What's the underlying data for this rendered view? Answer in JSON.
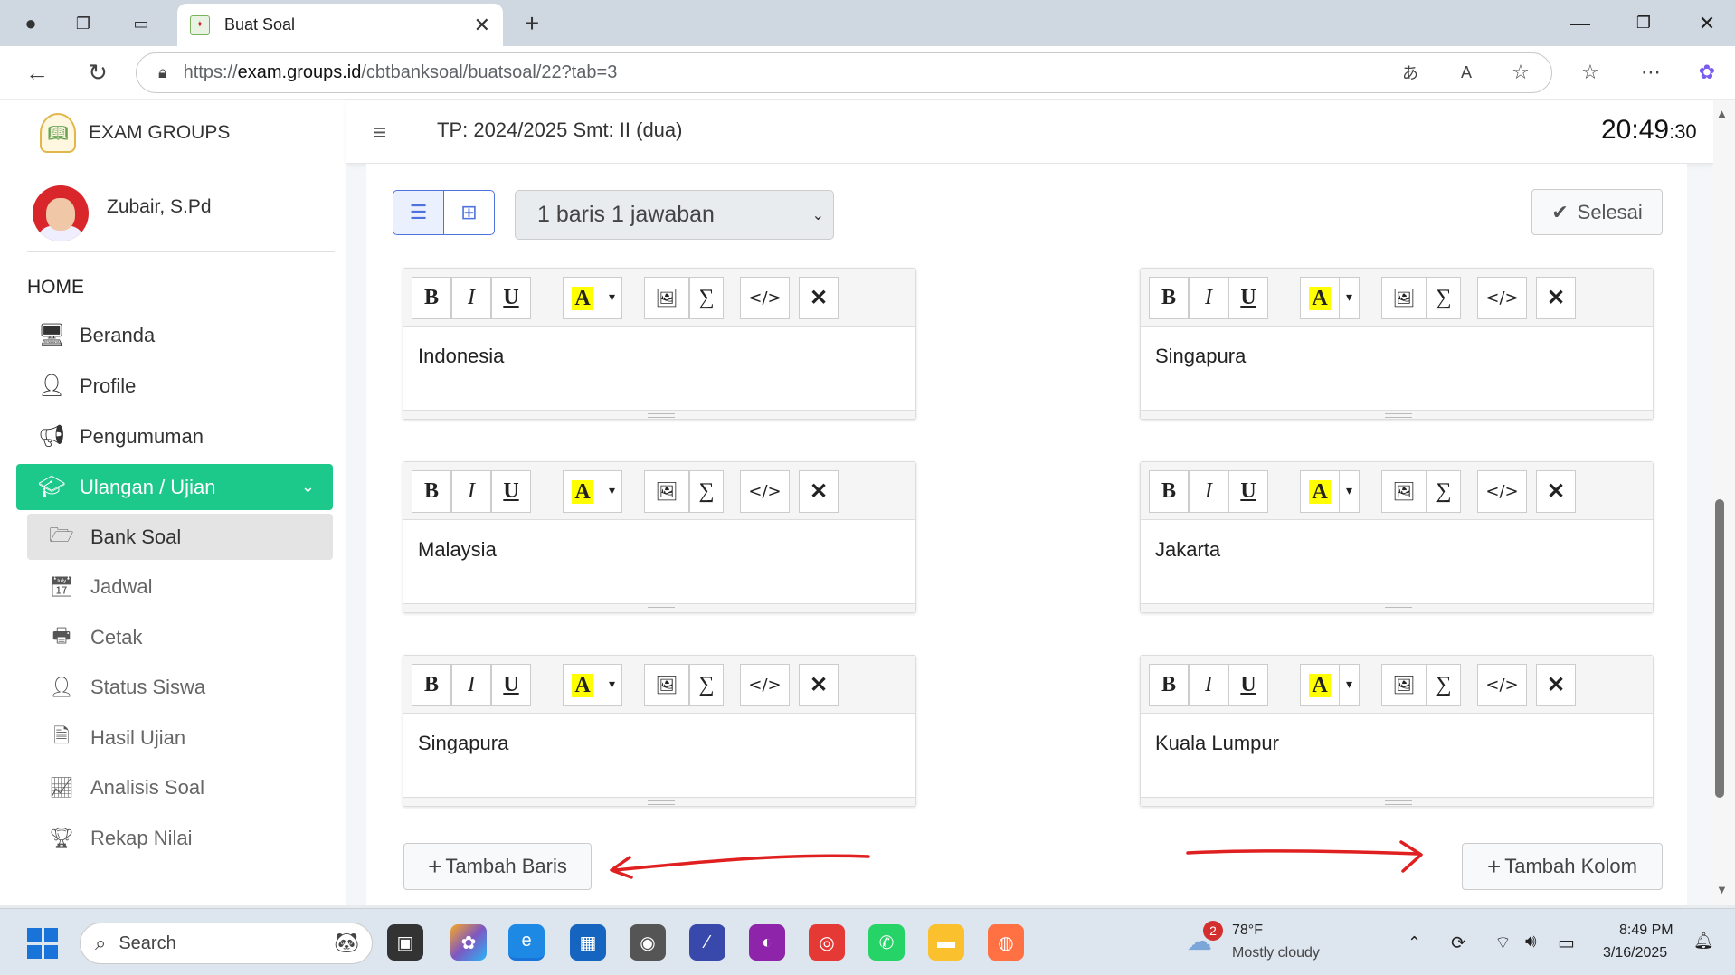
{
  "browser": {
    "tab_title": "Buat Soal",
    "url_prefix": "https://",
    "url_domain": "exam.groups.id",
    "url_path": "/cbtbanksoal/buatsoal/22?tab=3"
  },
  "sidebar": {
    "brand": "EXAM GROUPS",
    "user_name": "Zubair, S.Pd",
    "section_header": "HOME",
    "items": [
      {
        "label": "Beranda",
        "icon": "desktop-icon"
      },
      {
        "label": "Profile",
        "icon": "user-icon"
      },
      {
        "label": "Pengumuman",
        "icon": "bullhorn-icon"
      },
      {
        "label": "Ulangan / Ujian",
        "icon": "teacher-icon"
      }
    ],
    "subitems": [
      {
        "label": "Bank Soal",
        "icon": "folder-open-icon"
      },
      {
        "label": "Jadwal",
        "icon": "calendar-icon"
      },
      {
        "label": "Cetak",
        "icon": "print-icon"
      },
      {
        "label": "Status Siswa",
        "icon": "user-clock-icon"
      },
      {
        "label": "Hasil Ujian",
        "icon": "file-icon"
      },
      {
        "label": "Analisis Soal",
        "icon": "chart-line-icon"
      },
      {
        "label": "Rekap Nilai",
        "icon": "trophy-icon"
      }
    ]
  },
  "header": {
    "title": "TP: 2024/2025 Smt: II (dua)",
    "clock_hm": "20:49",
    "clock_s": ":30"
  },
  "toolbar": {
    "layout_select": "1 baris 1 jawaban",
    "done_label": "Selesai"
  },
  "editors": {
    "left": [
      "Indonesia",
      "Malaysia",
      "Singapura"
    ],
    "right": [
      "Singapura",
      "Jakarta",
      "Kuala Lumpur"
    ]
  },
  "buttons": {
    "add_row": "Tambah Baris",
    "add_column": "Tambah Kolom"
  },
  "taskbar": {
    "search_placeholder": "Search",
    "weather_badge": "2",
    "weather_temp": "78°F",
    "weather_desc": "Mostly cloudy",
    "time": "8:49 PM",
    "date": "3/16/2025"
  },
  "colors": {
    "accent_green": "#1cc88a",
    "primary_blue": "#4e73df",
    "annotation_red": "#e02020"
  }
}
